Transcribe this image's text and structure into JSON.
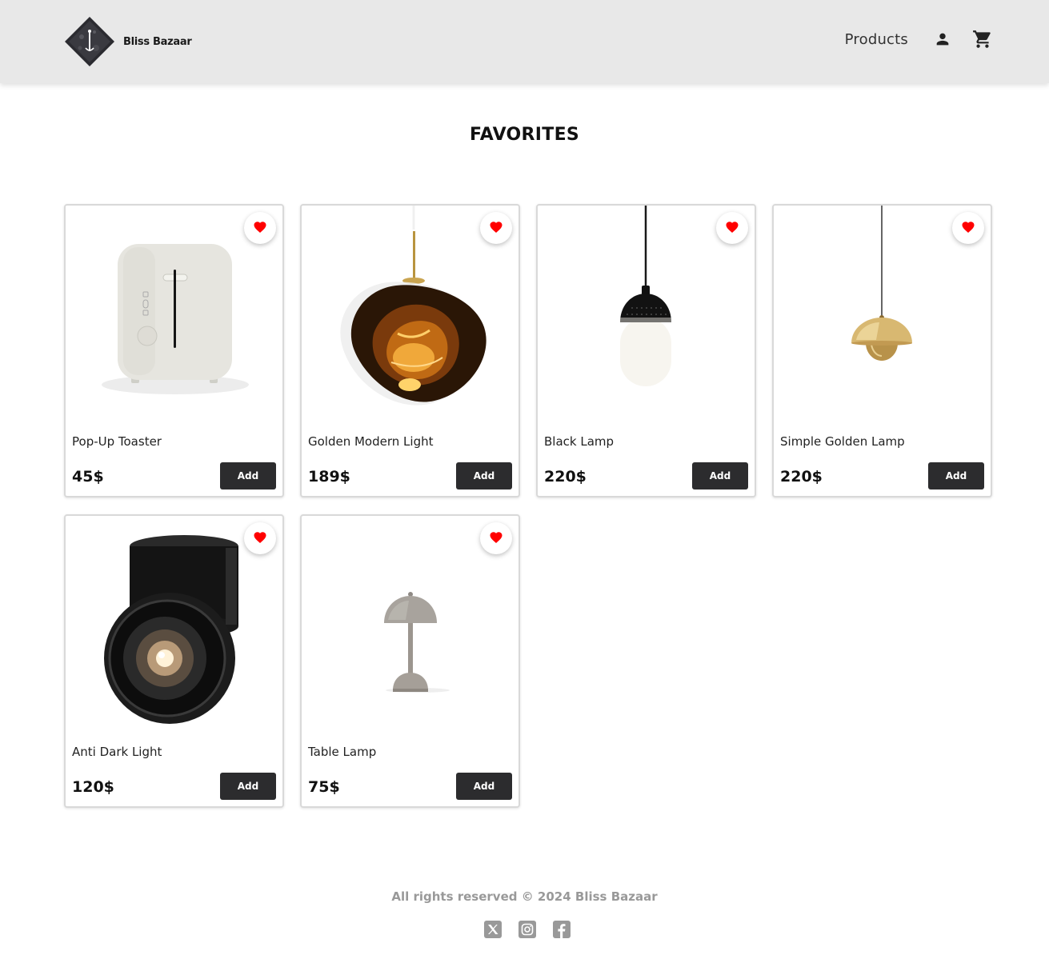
{
  "header": {
    "brand": "Bliss Bazaar",
    "nav_products": "Products",
    "icons": [
      "person-icon",
      "cart-icon"
    ]
  },
  "page": {
    "title": "FAVORITES"
  },
  "products": [
    {
      "name": "Pop-Up Toaster",
      "price": "45$",
      "add_label": "Add",
      "favorited": true,
      "image": "white-toaster"
    },
    {
      "name": "Golden Modern Light",
      "price": "189$",
      "add_label": "Add",
      "favorited": true,
      "image": "melt-pendant-lamp"
    },
    {
      "name": "Black Lamp",
      "price": "220$",
      "add_label": "Add",
      "favorited": true,
      "image": "black-white-pendant-lamp"
    },
    {
      "name": "Simple Golden Lamp",
      "price": "220$",
      "add_label": "Add",
      "favorited": true,
      "image": "gold-dome-pendant-lamp"
    },
    {
      "name": "Anti Dark Light",
      "price": "120$",
      "add_label": "Add",
      "favorited": true,
      "image": "black-spotlight"
    },
    {
      "name": "Table Lamp",
      "price": "75$",
      "add_label": "Add",
      "favorited": true,
      "image": "grey-mushroom-table-lamp"
    }
  ],
  "footer": {
    "copyright": "All rights reserved © 2024 Bliss Bazaar",
    "socials": [
      "x-icon",
      "instagram-icon",
      "facebook-icon"
    ]
  },
  "colors": {
    "header_bg": "#e8e8e8",
    "button_bg": "#2c2c2e",
    "heart": "#ff0000",
    "footer_text": "#999999"
  }
}
